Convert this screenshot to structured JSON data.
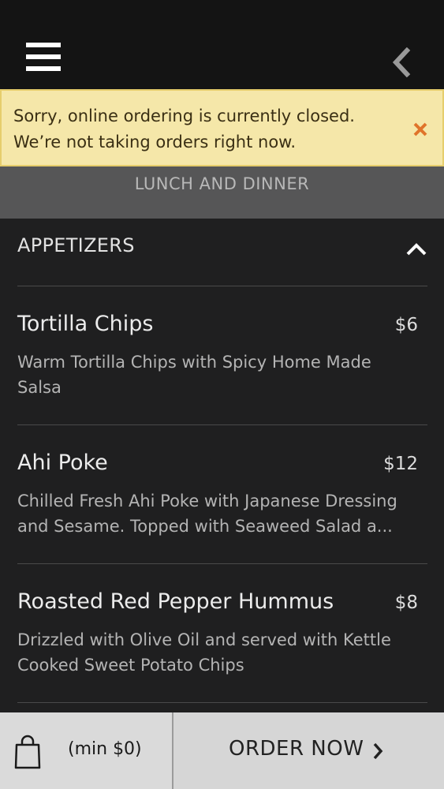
{
  "header": {
    "menu_icon": "hamburger-menu-icon",
    "back_icon": "chevron-left-icon"
  },
  "alert": {
    "line1": "Sorry, online ordering is currently closed.",
    "line2": "We’re not taking orders right now.",
    "close_icon": "close-icon",
    "close_color": "#e0742a"
  },
  "menu_category": "LUNCH AND DINNER",
  "section": {
    "title": "APPETIZERS",
    "toggle_icon": "chevron-up-icon"
  },
  "items": [
    {
      "name": "Tortilla Chips",
      "price": "$6",
      "desc_line1": "Warm Tortilla Chips with Spicy Home Made",
      "desc_line2": "Salsa"
    },
    {
      "name": "Ahi Poke",
      "price": "$12",
      "desc_line1": "Chilled Fresh Ahi Poke with Japanese Dressing",
      "desc_line2": "and Sesame. Topped with Seaweed Salad a..."
    },
    {
      "name": "Roasted Red Pepper Hummus",
      "price": "$8",
      "desc_line1": "Drizzled with Olive Oil and served with Kettle",
      "desc_line2": "Cooked Sweet Potato Chips"
    }
  ],
  "cart": {
    "icon": "shopping-bag-icon",
    "min_label": "(min $0)"
  },
  "order_button": {
    "label": "ORDER NOW",
    "icon": "chevron-right-icon"
  }
}
